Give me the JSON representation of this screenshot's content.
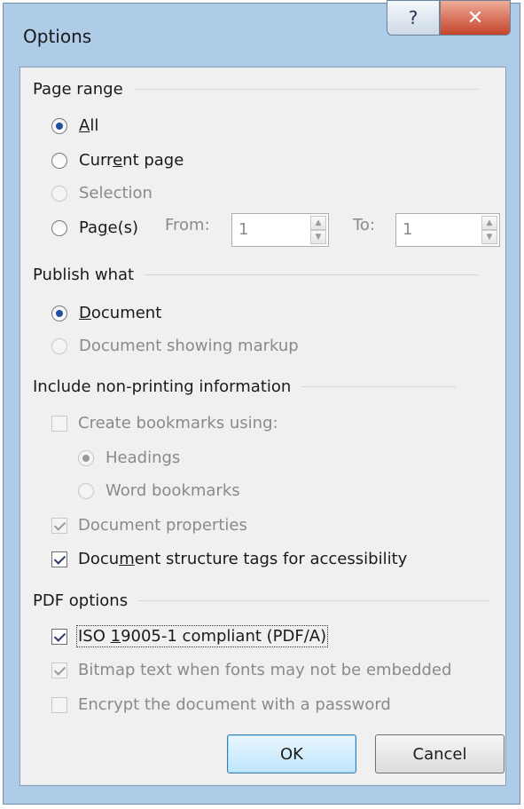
{
  "window": {
    "title": "Options",
    "help_button": "?",
    "close_button": "✕"
  },
  "page_range": {
    "heading": "Page range",
    "all": {
      "pre": "",
      "key": "A",
      "post": "ll",
      "selected": true
    },
    "current_page": {
      "pre": "Curr",
      "key": "e",
      "post": "nt page",
      "selected": false
    },
    "selection": {
      "label": "Selection",
      "enabled": false
    },
    "pages": {
      "pre": "Pa",
      "key": "g",
      "post": "e(s)",
      "selected": false
    },
    "from_label": "From:",
    "from_value": "1",
    "to_label": "To:",
    "to_value": "1"
  },
  "publish_what": {
    "heading": "Publish what",
    "document": {
      "pre": "",
      "key": "D",
      "post": "ocument",
      "selected": true
    },
    "document_markup": {
      "label": "Document showing markup",
      "enabled": false
    }
  },
  "non_printing": {
    "heading": "Include non-printing information",
    "create_bookmarks": {
      "label": "Create bookmarks using:",
      "checked": false,
      "enabled": false
    },
    "headings": {
      "label": "Headings",
      "selected": true,
      "enabled": false
    },
    "word_bookmarks": {
      "label": "Word bookmarks",
      "selected": false,
      "enabled": false
    },
    "doc_properties": {
      "label": "Document properties",
      "checked": true,
      "enabled": false
    },
    "structure_tags": {
      "pre": "Docu",
      "key": "m",
      "post": "ent structure tags for accessibility",
      "checked": true
    }
  },
  "pdf_options": {
    "heading": "PDF options",
    "iso": {
      "pre": "ISO ",
      "key": "1",
      "post": "9005-1 compliant (PDF/A)",
      "checked": true
    },
    "bitmap_text": {
      "label": "Bitmap text when fonts may not be embedded",
      "checked": true,
      "enabled": false
    },
    "encrypt": {
      "label": "Encrypt the document with a password",
      "checked": false,
      "enabled": false
    }
  },
  "buttons": {
    "ok": "OK",
    "cancel": "Cancel"
  },
  "colors": {
    "frame": "#aecbe8",
    "client": "#f0f0f0",
    "close_button": "#c5452a",
    "radio_dot": "#1f4f9e"
  }
}
